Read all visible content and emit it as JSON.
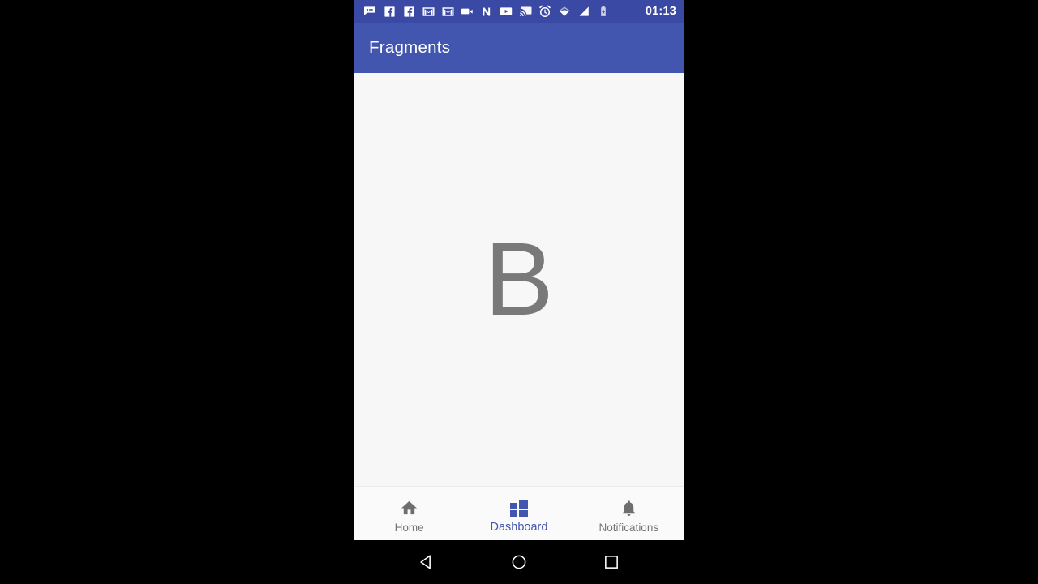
{
  "device": {
    "screen_background": "#f7f7f8",
    "letterbox_color": "#000000"
  },
  "status_bar": {
    "background": "#3a49a4",
    "clock": "01:13",
    "icons": [
      {
        "name": "messages-icon",
        "label": "Messages"
      },
      {
        "name": "facebook-icon",
        "label": "Facebook"
      },
      {
        "name": "facebook-icon-2",
        "label": "Facebook"
      },
      {
        "name": "gmail-icon",
        "label": "Gmail"
      },
      {
        "name": "gmail-icon-2",
        "label": "Gmail"
      },
      {
        "name": "video-camera-icon",
        "label": "Video"
      },
      {
        "name": "nova-launcher-icon",
        "label": "N"
      },
      {
        "name": "youtube-icon",
        "label": "YouTube"
      },
      {
        "name": "cast-icon",
        "label": "Cast"
      },
      {
        "name": "alarm-clock-icon",
        "label": "Alarm"
      },
      {
        "name": "wifi-icon",
        "label": "Wi-Fi"
      },
      {
        "name": "cell-signal-icon",
        "label": "Signal"
      },
      {
        "name": "battery-charging-icon",
        "label": "Battery"
      }
    ]
  },
  "app_bar": {
    "title": "Fragments",
    "background": "#4256b0",
    "title_color": "#ffffff"
  },
  "content": {
    "fragment_letter": "B",
    "letter_color": "#797979",
    "background": "#f7f7f8"
  },
  "bottom_nav": {
    "background": "#fafafa",
    "active_color": "#4256b0",
    "inactive_color": "#757575",
    "items": [
      {
        "label": "Home",
        "icon": "home-icon",
        "active": false
      },
      {
        "label": "Dashboard",
        "icon": "dashboard-grid-icon",
        "active": true
      },
      {
        "label": "Notifications",
        "icon": "bell-icon",
        "active": false
      }
    ]
  },
  "system_nav": {
    "background": "#000000",
    "buttons": [
      {
        "name": "back-button",
        "icon": "triangle-left-icon"
      },
      {
        "name": "home-button",
        "icon": "circle-icon"
      },
      {
        "name": "recents-button",
        "icon": "square-icon"
      }
    ]
  }
}
